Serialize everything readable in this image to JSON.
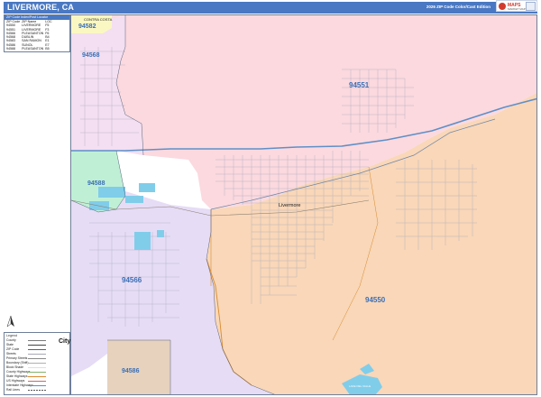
{
  "header": {
    "title": "LIVERMORE, CA",
    "edition": "2026 ZIP Code Color/Cast Edition",
    "brand_name": "MAPS",
    "brand_sub": "MARKET MAPS",
    "colors": {
      "bar": "#4a78c2",
      "text": "#ffffff"
    }
  },
  "zip_index": {
    "title": "ZIP Code Index/Post Locator",
    "columns": [
      "ZIP Code",
      "ZIP Name",
      "LOC"
    ],
    "rows": [
      [
        "94550",
        "LIVERMORE",
        "F5"
      ],
      [
        "94551",
        "LIVERMORE",
        "F3"
      ],
      [
        "94566",
        "PLEASANTON",
        "F6"
      ],
      [
        "94568",
        "DUBLIN",
        "B4"
      ],
      [
        "94583",
        "SAN RAMON",
        "E1"
      ],
      [
        "94586",
        "SUNOL",
        "E7"
      ],
      [
        "94588",
        "PLEASANTON",
        "B5"
      ]
    ]
  },
  "map": {
    "zip_labels": [
      "94582",
      "94568",
      "94551",
      "94588",
      "94566",
      "94550",
      "94586"
    ],
    "city_label": "Livermore",
    "lake_label": "LAKE DEL VALLE",
    "area_label": "CONTRA COSTA",
    "zone_colors": {
      "94551": "#fbd9df",
      "94550": "#f9d7b8",
      "94566": "#e6dcf6",
      "94568": "#f3dff1",
      "94588": "#bff0d6",
      "94586": "#e6d2bd",
      "94582": "#fbf7c2",
      "water": "#80cdea",
      "highway": "#5f8fc7",
      "zip_text": "#3b6fb6"
    }
  },
  "legend": {
    "title": "Legend",
    "city_symbol": "City",
    "rows": [
      {
        "label": "County",
        "desc": "county line"
      },
      {
        "label": "State",
        "desc": "state line"
      },
      {
        "label": "ZIP Code",
        "desc": "zip boundary"
      },
      {
        "label": "Streets",
        "desc": "local street"
      },
      {
        "label": "Primary Streets",
        "desc": "primary street"
      },
      {
        "label": "Boundary (Shift)",
        "desc": "boundary"
      },
      {
        "label": "Block Shade",
        "desc": "shade"
      },
      {
        "label": "County Highways",
        "desc": "highway"
      },
      {
        "label": "State Highways",
        "desc": "highway"
      },
      {
        "label": "US Highways",
        "desc": "highway"
      },
      {
        "label": "Interstate Highways",
        "desc": "interstate"
      },
      {
        "label": "Rail Lines",
        "desc": "rail"
      }
    ]
  }
}
